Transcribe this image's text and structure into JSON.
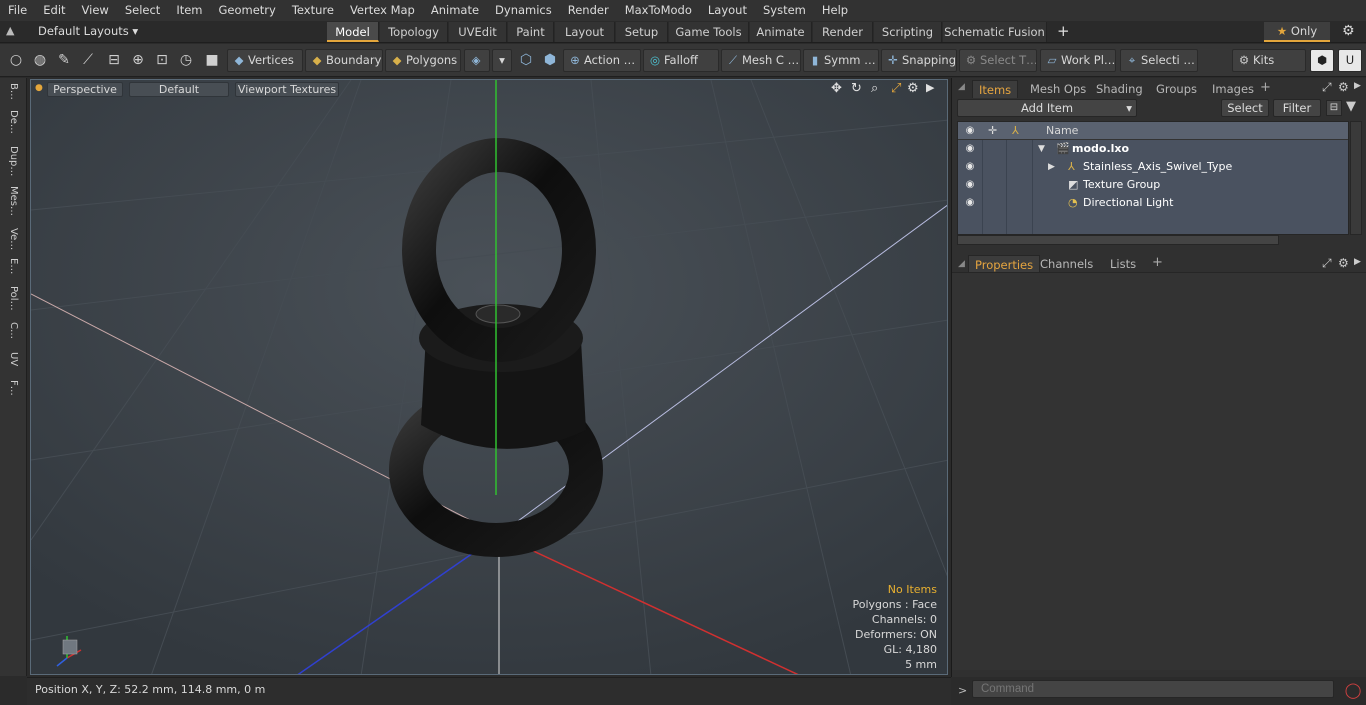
{
  "menu": [
    "File",
    "Edit",
    "View",
    "Select",
    "Item",
    "Geometry",
    "Texture",
    "Vertex Map",
    "Animate",
    "Dynamics",
    "Render",
    "MaxToModo",
    "Layout",
    "System",
    "Help"
  ],
  "layout_bar": {
    "layout_select": "Default Layouts",
    "tabs": [
      "Model",
      "Topology",
      "UVEdit",
      "Paint",
      "Layout",
      "Setup",
      "Game Tools",
      "Animate",
      "Render",
      "Scripting",
      "Schematic Fusion"
    ],
    "active_tab": "Model",
    "only_label": "Only"
  },
  "toolbar": {
    "vertices": "Vertices",
    "boundary": "Boundary",
    "polygons": "Polygons",
    "action": "Action …",
    "falloff": "Falloff",
    "mesh_c": "Mesh C …",
    "symm": "Symm …",
    "snapping": "Snapping",
    "select_t": "Select T…",
    "work_pl": "Work Pl…",
    "selecti": "Selecti …",
    "kits": "Kits"
  },
  "left_strip": [
    "B…",
    "De…",
    "Dup…",
    "Mes…",
    "Ve…",
    "E…",
    "Pol…",
    "C…",
    "UV",
    "F…"
  ],
  "viewport": {
    "view_type": "Perspective",
    "shading": "Default",
    "textures": "Viewport Textures",
    "info": {
      "selection": "No Items",
      "polygons": "Polygons : Face",
      "channels": "Channels: 0",
      "deformers": "Deformers: ON",
      "gl": "GL: 4,180",
      "scale": "5 mm"
    },
    "selection_color": "#e8b030"
  },
  "status": {
    "position": "Position X, Y, Z:   52.2 mm, 114.8 mm, 0 m"
  },
  "items_panel": {
    "tabs": [
      "Items",
      "Mesh Ops",
      "Shading",
      "Groups",
      "Images"
    ],
    "active_tab": "Items",
    "add_item": "Add Item",
    "select": "Select",
    "filter": "Filter",
    "column_name": "Name",
    "rows": [
      {
        "label": "modo.lxo",
        "bold": true
      },
      {
        "label": "Stainless_Axis_Swivel_Type"
      },
      {
        "label": "Texture Group"
      },
      {
        "label": "Directional Light"
      }
    ]
  },
  "properties_panel": {
    "tabs": [
      "Properties",
      "Channels",
      "Lists"
    ],
    "active_tab": "Properties"
  },
  "command": {
    "placeholder": "Command",
    "prompt": ">"
  }
}
